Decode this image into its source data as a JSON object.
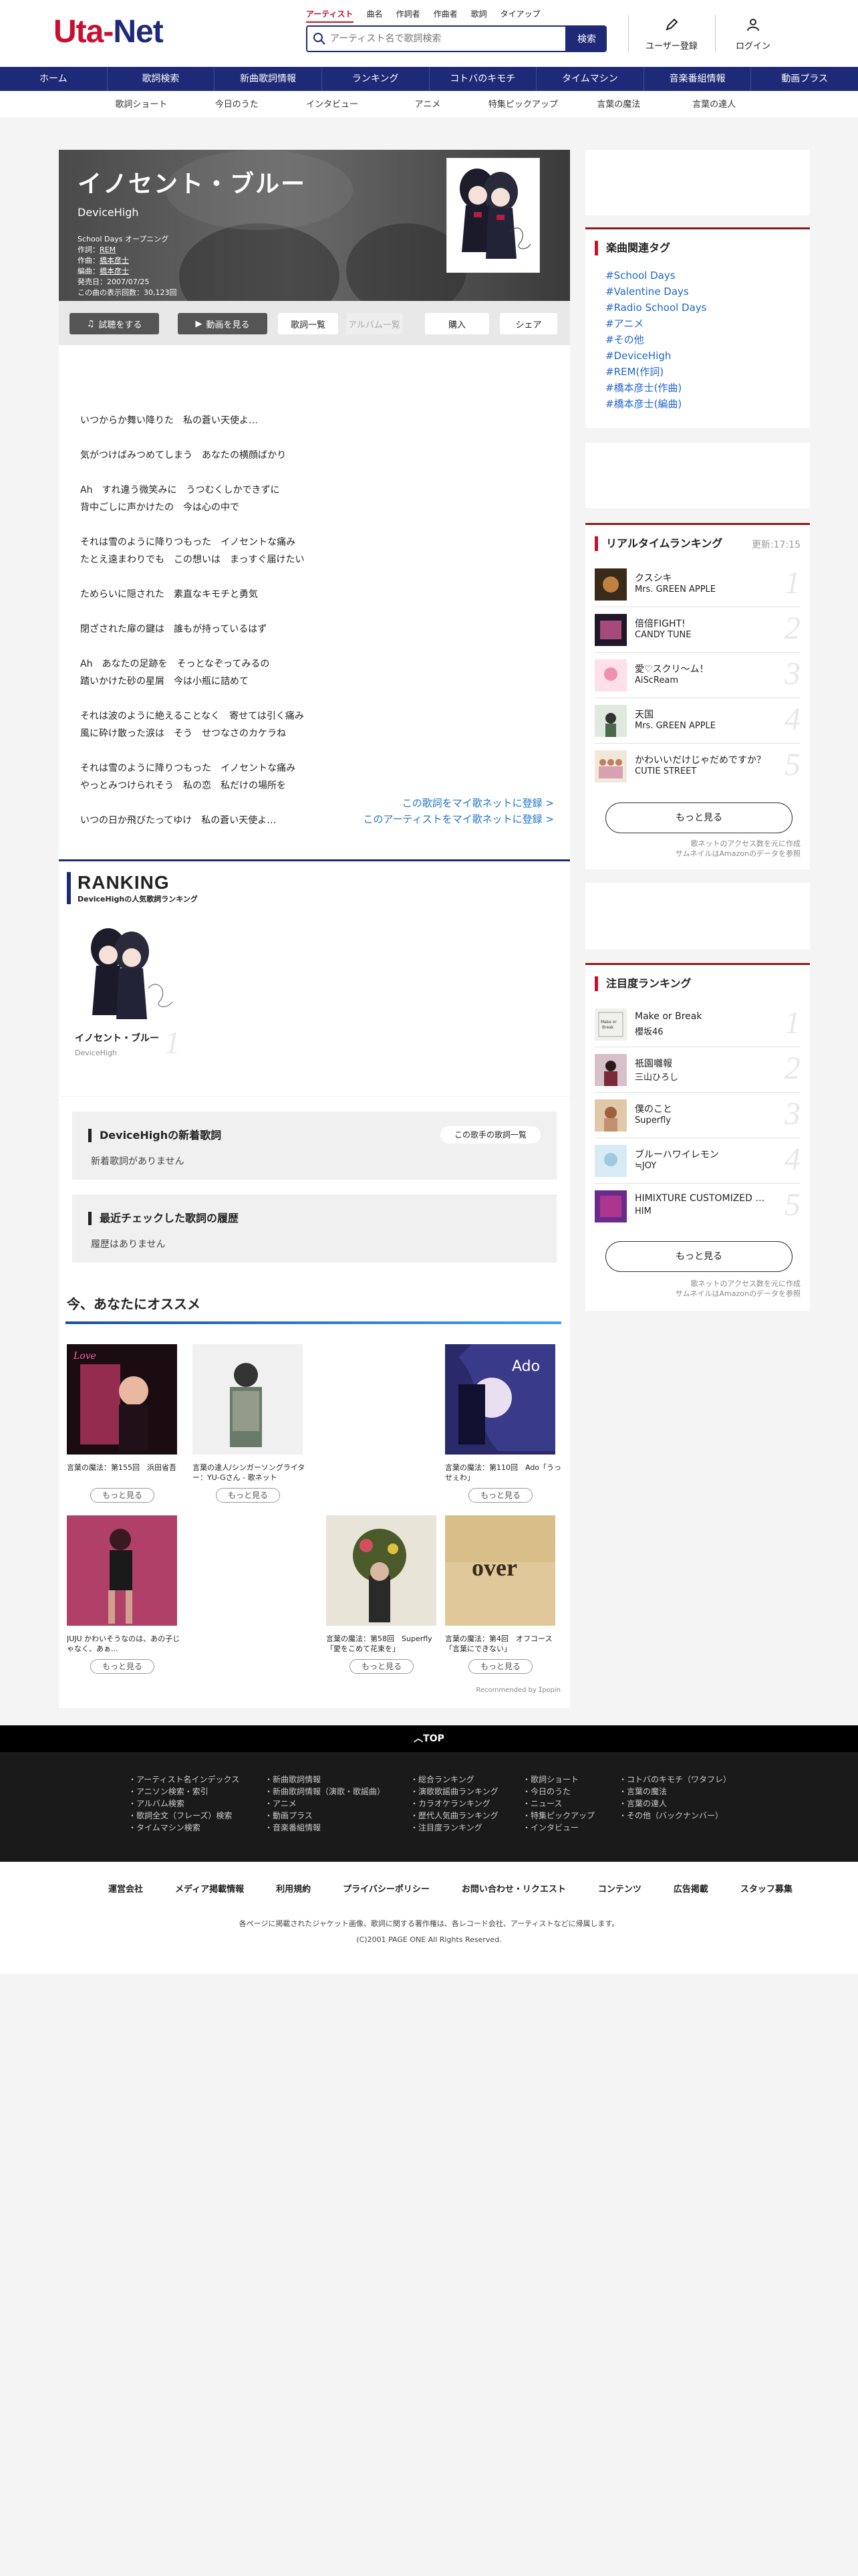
{
  "header": {
    "logo_left": "Uta-",
    "logo_right": "Net",
    "search_tabs": [
      "アーティスト",
      "曲名",
      "作詞者",
      "作曲者",
      "歌詞",
      "タイアップ"
    ],
    "search_placeholder": "アーティスト名で歌詞検索",
    "search_button": "検索",
    "register_label": "ユーザー登録",
    "login_label": "ログイン"
  },
  "main_nav": [
    "ホーム",
    "歌詞検索",
    "新曲歌詞情報",
    "ランキング",
    "コトバのキモチ",
    "タイムマシン",
    "音楽番組情報",
    "動画プラス"
  ],
  "sub_nav": [
    "歌詞ショート",
    "今日のうた",
    "インタビュー",
    "アニメ",
    "特集ピックアップ",
    "言葉の魔法",
    "言葉の達人"
  ],
  "song": {
    "title": "イノセント・ブルー",
    "artist": "DeviceHigh",
    "tieup": "School Days オープニング",
    "lyricist_label": "作詞：",
    "lyricist": "REM",
    "composer_label": "作曲：",
    "composer": "橋本彦士",
    "arranger_label": "編曲：",
    "arranger": "橋本彦士",
    "release": "発売日：2007/07/25",
    "views": "この曲の表示回数：30,123回"
  },
  "hero_buttons": {
    "listen": "試聴をする",
    "video": "動画を見る",
    "lyrics_list": "歌詞一覧",
    "album_list": "アルバム一覧",
    "buy": "購入",
    "share": "シェア"
  },
  "lyrics": "いつからか舞い降りた　私の蒼い天使よ…\n\n気がつけばみつめてしまう　あなたの横顔ばかり\n\nAh　すれ違う微笑みに　うつむくしかできずに\n背中ごしに声かけたの　今は心の中で\n\nそれは雪のように降りつもった　イノセントな痛み\nたとえ遠まわりでも　この想いは　まっすぐ届けたい\n\nためらいに隠された　素直なキモチと勇気\n\n閉ざされた扉の鍵は　誰もが持っているはず\n\nAh　あなたの足跡を　そっとなぞってみるの\n踏いかけた砂の星屑　今は小瓶に詰めて\n\nそれは波のように絶えることなく　寄せては引く痛み\n風に砕け散った涙は　そう　せつなさのカケラね\n\nそれは雪のように降りつもった　イノセントな痛み\nやっとみつけられそう　私の恋　私だけの場所を\n\nいつの日か飛びたってゆけ　私の蒼い天使よ…",
  "lyrics_links": {
    "register_lyric": "この歌詞をマイ歌ネットに登録 >",
    "register_artist": "このアーティストをマイ歌ネットに登録 >"
  },
  "ranking": {
    "title": "RANKING",
    "subtitle": "DeviceHighの人気歌詞ランキング",
    "song": "イノセント・ブルー",
    "artist": "DeviceHigh",
    "num": "1"
  },
  "new_songs": {
    "heading": "DeviceHighの新着歌詞",
    "button": "この歌手の歌詞一覧",
    "empty": "新着歌詞がありません"
  },
  "history": {
    "heading": "最近チェックした歌詞の履歴",
    "empty": "履歴はありません"
  },
  "recommend": {
    "title": "今、あなたにオススメ",
    "more": "もっと見る",
    "items": [
      {
        "caption": "言葉の魔法：第155回　浜田省吾"
      },
      {
        "caption": "言葉の達人/シンガーソングライター：YU-Gさん - 歌ネット"
      },
      {
        "caption": "言葉の魔法：第110回　Ado「うっせぇわ」"
      },
      {
        "caption": "JUJU かわいそうなのは、あの子じゃなく、あぁ..."
      },
      {
        "caption": "言葉の魔法：第58回　Superfly「愛をこめて花束を」"
      },
      {
        "caption": "言葉の魔法：第4回　オフコース「言葉にできない」"
      }
    ],
    "popin": "Recommended by ⵊpopin"
  },
  "side_tags": {
    "heading": "楽曲関連タグ",
    "tags": [
      "#School Days",
      "#Valentine Days",
      "#Radio School Days",
      "#アニメ",
      "#その他",
      "#DeviceHigh",
      "#REM(作詞)",
      "#橋本彦士(作曲)",
      "#橋本彦士(編曲)"
    ]
  },
  "realtime": {
    "heading": "リアルタイムランキング",
    "updated": "更新:17:15",
    "rows": [
      {
        "title": "クスシキ",
        "artist": "Mrs. GREEN APPLE",
        "num": "1"
      },
      {
        "title": "倍倍FIGHT!",
        "artist": "CANDY TUNE",
        "num": "2"
      },
      {
        "title": "愛♡スクリ～ム！",
        "artist": "AiScReam",
        "num": "3"
      },
      {
        "title": "天国",
        "artist": "Mrs. GREEN APPLE",
        "num": "4"
      },
      {
        "title": "かわいいだけじゃだめですか？",
        "artist": "CUTIE STREET",
        "num": "5"
      }
    ],
    "more": "もっと見る",
    "note1": "歌ネットのアクセス数を元に作成",
    "note2": "サムネイルはAmazonのデータを参照"
  },
  "attention": {
    "heading": "注目度ランキング",
    "rows": [
      {
        "title": "Make or Break",
        "artist": "櫻坂46",
        "num": "1"
      },
      {
        "title": "祇園囃報",
        "artist": "三山ひろし",
        "num": "2"
      },
      {
        "title": "僕のこと",
        "artist": "Superfly",
        "num": "3"
      },
      {
        "title": "ブルーハワイレモン",
        "artist": "≒JOY",
        "num": "4"
      },
      {
        "title": "HIMIXTURE CUSTOMIZED 3...",
        "artist": "HIM",
        "num": "5"
      }
    ],
    "more": "もっと見る",
    "note1": "歌ネットのアクセス数を元に作成",
    "note2": "サムネイルはAmazonのデータを参照"
  },
  "footer": {
    "top": "TOP",
    "col1": [
      "・アーティスト名インデックス",
      "・アニソン検索・索引",
      "・アルバム検索",
      "・歌詞全文（フレーズ）検索",
      "・タイムマシン検索"
    ],
    "col2": [
      "・新曲歌詞情報",
      "・新曲歌詞情報（演歌・歌謡曲）",
      "・アニメ",
      "・動画プラス",
      "・音楽番組情報"
    ],
    "col3": [
      "・総合ランキング",
      "・演歌歌謡曲ランキング",
      "・カラオケランキング",
      "・歴代人気曲ランキング",
      "・注目度ランキング"
    ],
    "col4": [
      "・歌詞ショート",
      "・今日のうた",
      "・ニュース",
      "・特集ピックアップ",
      "・インタビュー"
    ],
    "col5": [
      "・コトバのキモチ（ワタフレ）",
      "・言葉の魔法",
      "・言葉の達人",
      "・その他（バックナンバー）"
    ],
    "nav": [
      "運営会社",
      "メディア掲載情報",
      "利用規約",
      "プライバシーポリシー",
      "お問い合わせ・リクエスト",
      "コンテンツ",
      "広告掲載",
      "スタッフ募集"
    ],
    "copy1": "各ページに掲載されたジャケット画像、歌詞に関する著作権は、各レコード会社、アーティストなどに帰属します。",
    "copy2": "(C)2001 PAGE ONE All Rights Reserved."
  }
}
